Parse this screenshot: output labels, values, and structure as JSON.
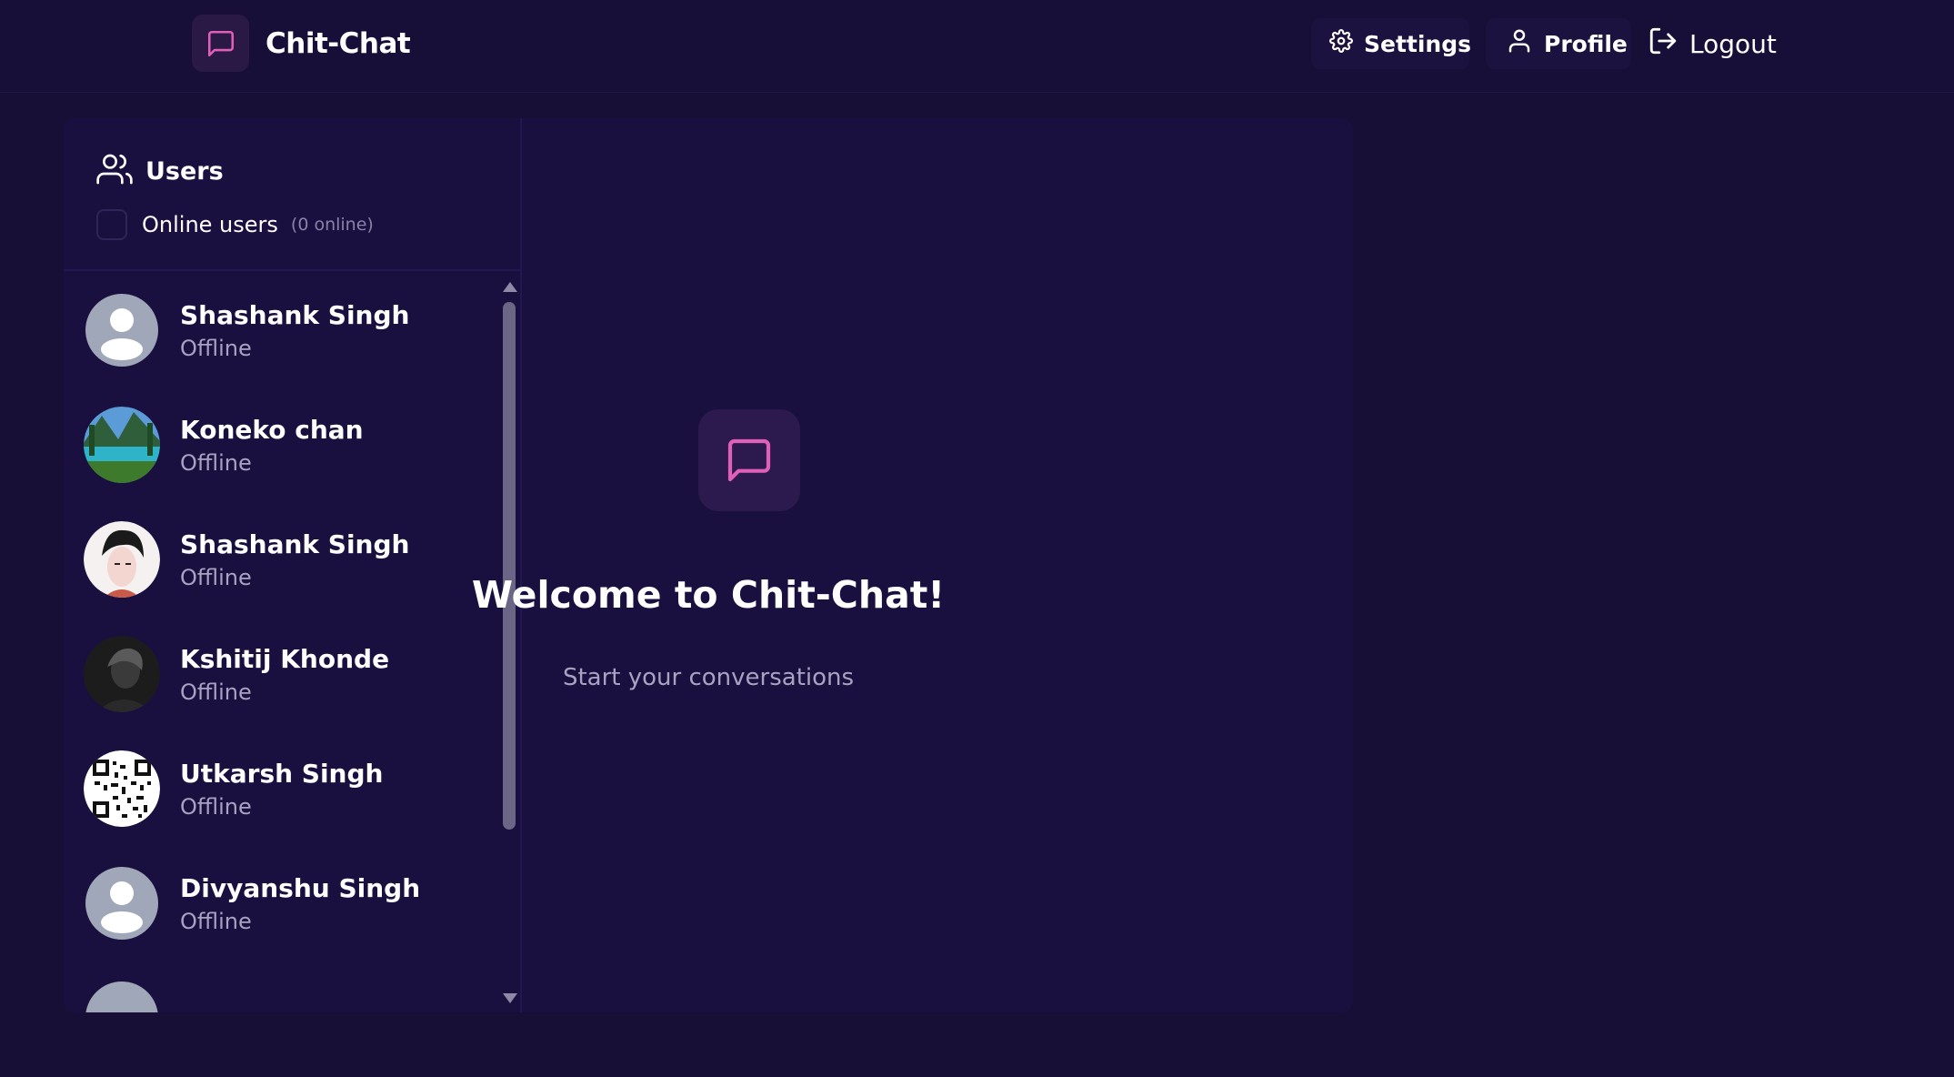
{
  "app": {
    "name": "Chit-Chat"
  },
  "nav": {
    "settings_label": "Settings",
    "profile_label": "Profile",
    "logout_label": "Logout"
  },
  "sidebar": {
    "title": "Users",
    "online_filter_label": "Online users",
    "online_count": "(0 online)",
    "users": [
      {
        "name": "Shashank Singh",
        "status": "Offline",
        "avatar": "default-avatar"
      },
      {
        "name": "Koneko chan",
        "status": "Offline",
        "avatar": "landscape-photo"
      },
      {
        "name": "Shashank Singh",
        "status": "Offline",
        "avatar": "anime-portrait"
      },
      {
        "name": "Kshitij Khonde",
        "status": "Offline",
        "avatar": "dark-portrait"
      },
      {
        "name": "Utkarsh Singh",
        "status": "Offline",
        "avatar": "qr-code-image"
      },
      {
        "name": "Divyanshu Singh",
        "status": "Offline",
        "avatar": "default-avatar"
      }
    ]
  },
  "welcome": {
    "title": "Welcome to Chit-Chat!",
    "subtitle": "Start your conversations"
  },
  "colors": {
    "background": "#170f35",
    "panel": "#1a1040",
    "accent": "#e05fb8",
    "muted_text": "#a8a3c0"
  }
}
